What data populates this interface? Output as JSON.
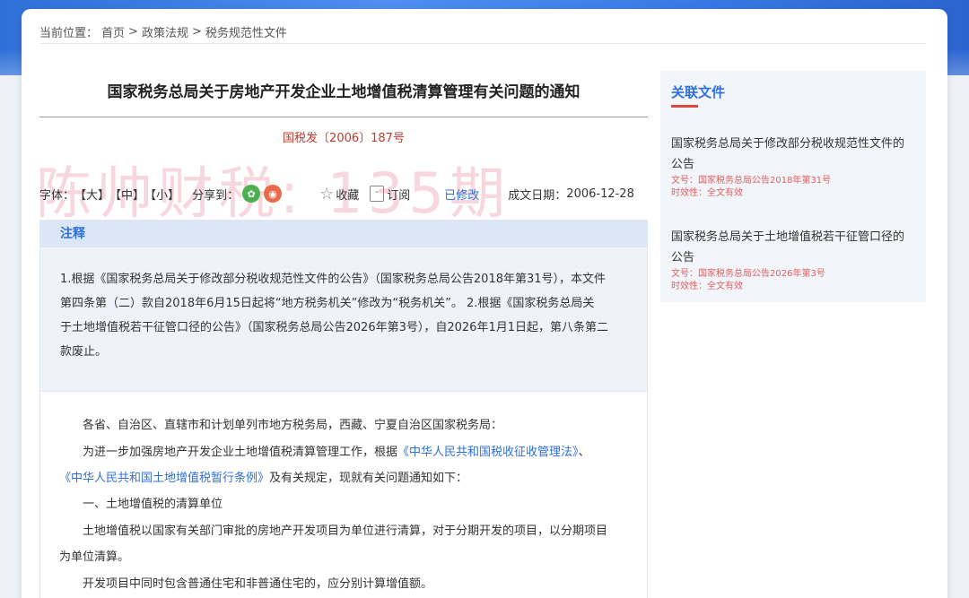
{
  "breadcrumb": {
    "label": "当前位置：",
    "items": [
      "首页",
      "政策法规",
      "税务规范性文件"
    ],
    "separator": ">"
  },
  "document": {
    "title": "国家税务总局关于房地产开发企业土地增值税清算管理有关问题的通知",
    "number": "国税发〔2006〕187号"
  },
  "watermark": "陈帅财税: 135期",
  "toolbar": {
    "font_label": "字体：",
    "sizes": [
      "【大】",
      "【中】",
      "【小】"
    ],
    "share_label": "分享到：",
    "wechat_glyph": "✿",
    "weibo_glyph": "◉",
    "favorite_label": "收藏",
    "subscribe_label": "订阅",
    "status_prefix": "已",
    "status_value": "修改",
    "date_label": "成文日期：",
    "date_value": "2006-12-28"
  },
  "note": {
    "header": "注释",
    "lines": [
      "1.根据《国家税务总局关于修改部分税收规范性文件的公告》（国家税务总局公告2018年第31号），本文件",
      "第四条第（二）款自2018年6月15日起将“地方税务机关”修改为“税务机关”。 2.根据《国家税务总局关",
      "于土地增值税若干征管口径的公告》（国家税务总局公告2026年第3号），自2026年1月1日起，第八条第二",
      "款废止。"
    ]
  },
  "body": {
    "addressee": "各省、自治区、直辖市和计划单列市地方税务局，西藏、宁夏自治区国家税务局：",
    "intro_prefix": "为进一步加强房地产开发企业土地增值税清算管理工作，根据",
    "law1": "《中华人民共和国税收征收管理法》",
    "intro_comma": "、",
    "law2": "《中华人民共和国土地增值税暂行条例》",
    "intro_suffix": "及有关规定，现就有关问题通知如下：",
    "section1": "一、土地增值税的清算单位",
    "p1_line1": "土地增值税以国家有关部门审批的房地产开发项目为单位进行清算，对于分期开发的项目，以分期项目",
    "p1_line2": "为单位清算。",
    "p2": "开发项目中同时包含普通住宅和非普通住宅的，应分别计算增值额。"
  },
  "sidebar": {
    "title": "关联文件",
    "items": [
      {
        "title_line1": "国家税务总局关于修改部分税收规范性文件的",
        "title_line2": "公告",
        "doc_no": "文号：国家税务总局公告2018年第31号",
        "validity": "时效性：全文有效"
      },
      {
        "title_line1": "国家税务总局关于土地增值税若干征管口径的",
        "title_line2": "公告",
        "doc_no": "文号：国家税务总局公告2026年第3号",
        "validity": "时效性：全文有效"
      }
    ]
  },
  "colors": {
    "accent_blue": "#2f6fd8",
    "doc_number_red": "#c0392b",
    "meta_red": "#e06060"
  }
}
